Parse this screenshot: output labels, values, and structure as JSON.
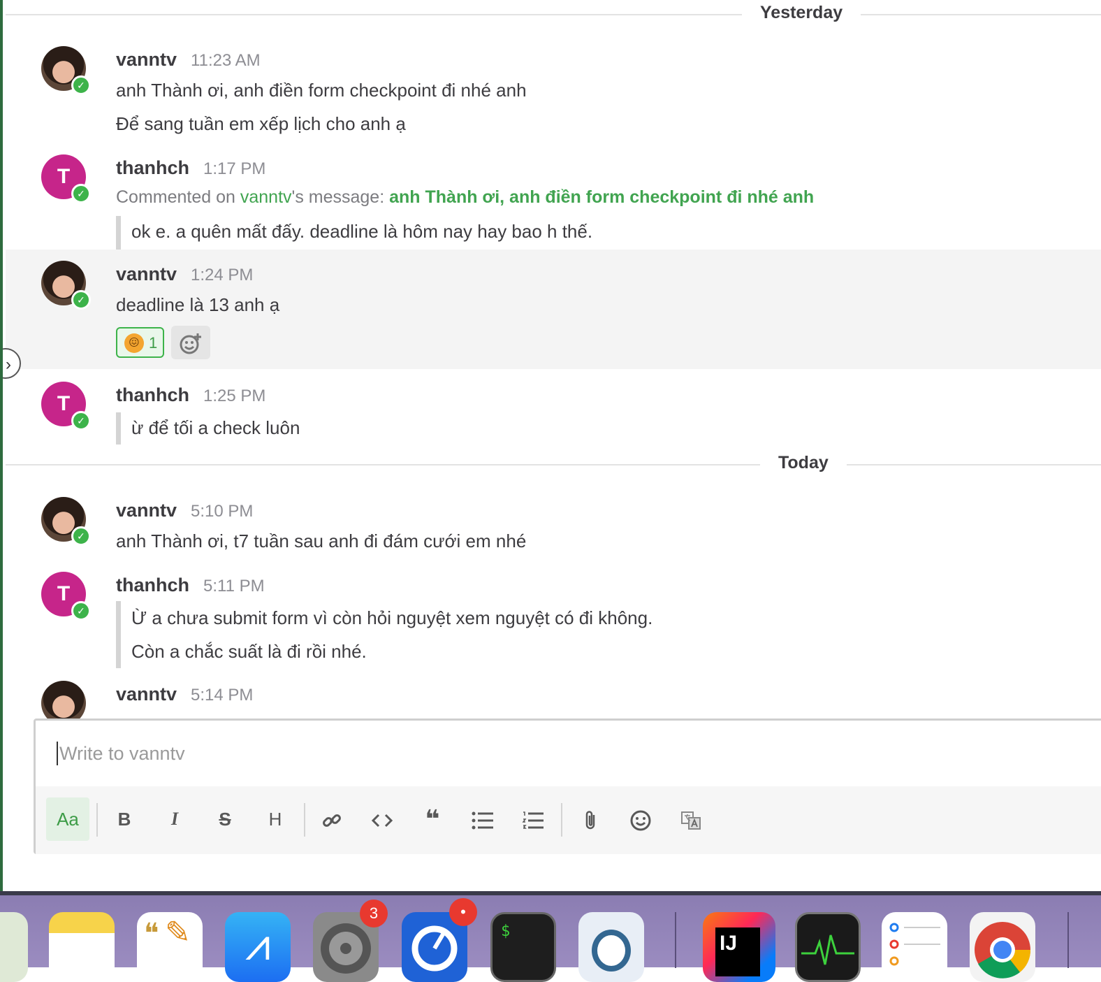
{
  "separators": {
    "yesterday": "Yesterday",
    "today": "Today"
  },
  "messages": [
    {
      "user": "vanntv",
      "time": "11:23 AM",
      "lines": [
        "anh Thành ơi, anh điền form checkpoint đi nhé anh",
        "Để sang tuần em xếp lịch cho anh ạ"
      ]
    },
    {
      "user": "thanhch",
      "avatar_letter": "T",
      "time": "1:17 PM",
      "comment": {
        "prefix": "Commented on ",
        "target_user": "vanntv",
        "mid": "'s message: ",
        "quoted_msg": "anh Thành ơi, anh điền form checkpoint đi nhé anh"
      },
      "quote_lines": [
        "ok e. a quên mất đấy. deadline là hôm nay hay bao h thế."
      ]
    },
    {
      "user": "vanntv",
      "time": "1:24 PM",
      "lines": [
        "deadline là 13 anh ạ"
      ],
      "reaction": {
        "emoji": "😖",
        "count": "1"
      }
    },
    {
      "user": "thanhch",
      "avatar_letter": "T",
      "time": "1:25 PM",
      "quote_lines": [
        "ừ để tối a check luôn"
      ]
    },
    {
      "user": "vanntv",
      "time": "5:10 PM",
      "lines": [
        "anh Thành ơi, t7 tuần sau anh đi đám cưới em nhé"
      ]
    },
    {
      "user": "thanhch",
      "avatar_letter": "T",
      "time": "5:11 PM",
      "quote_lines": [
        "Ừ a chưa submit form vì còn hỏi nguyệt xem nguyệt có đi không.",
        "Còn a chắc suất là đi rồi nhé."
      ]
    },
    {
      "user": "vanntv",
      "time": "5:14 PM"
    }
  ],
  "composer": {
    "placeholder": "Write to vanntv",
    "toolbar": {
      "format": "Aa",
      "bold": "B",
      "italic": "I",
      "strike": "S",
      "heading": "H"
    }
  },
  "dock": {
    "badges": {
      "system_preferences": "3",
      "alert_app": "•"
    },
    "intellij_label": "IJ",
    "terminal_label": "$"
  },
  "colors": {
    "accent": "#41a450",
    "status_online": "#3db34a",
    "avatar_t": "#c6258a",
    "badge": "#e8392f"
  }
}
